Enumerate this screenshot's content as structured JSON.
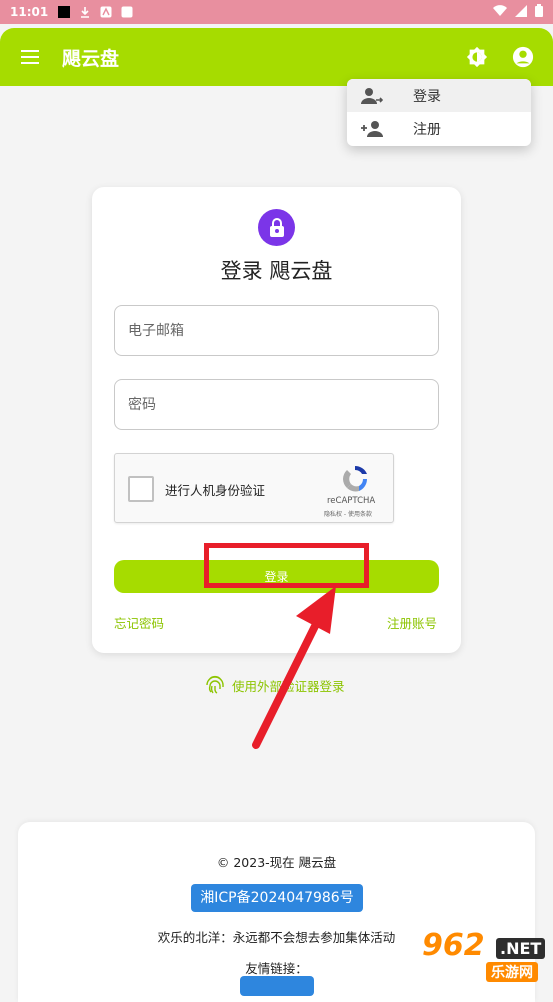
{
  "status_bar": {
    "time": "11:01"
  },
  "app_bar": {
    "title": "飓云盘"
  },
  "dropdown": {
    "items": [
      {
        "label": "登录"
      },
      {
        "label": "注册"
      }
    ]
  },
  "login": {
    "title": "登录 飓云盘",
    "email_placeholder": "电子邮箱",
    "password_placeholder": "密码",
    "captcha_label": "进行人机身份验证",
    "captcha_brand": "reCAPTCHA",
    "captcha_terms": "隐私权 - 使用条款",
    "login_button": "登录",
    "forgot_password": "忘记密码",
    "register": "注册账号"
  },
  "external_login": "使用外部验证器登录",
  "footer": {
    "copyright": "© 2023-现在 飓云盘",
    "icp": "湘ICP备2024047986号",
    "motto": "欢乐的北洋：永远都不会想去参加集体活动",
    "friends_label": "友情链接："
  },
  "watermark": {
    "brand": "962",
    "net": ".NET",
    "sub": "乐游网"
  },
  "colors": {
    "accent": "#a6dc00",
    "link": "#8cc400",
    "lock": "#7b35e8",
    "icp": "#2e86de",
    "annotation": "#e81e2a"
  }
}
